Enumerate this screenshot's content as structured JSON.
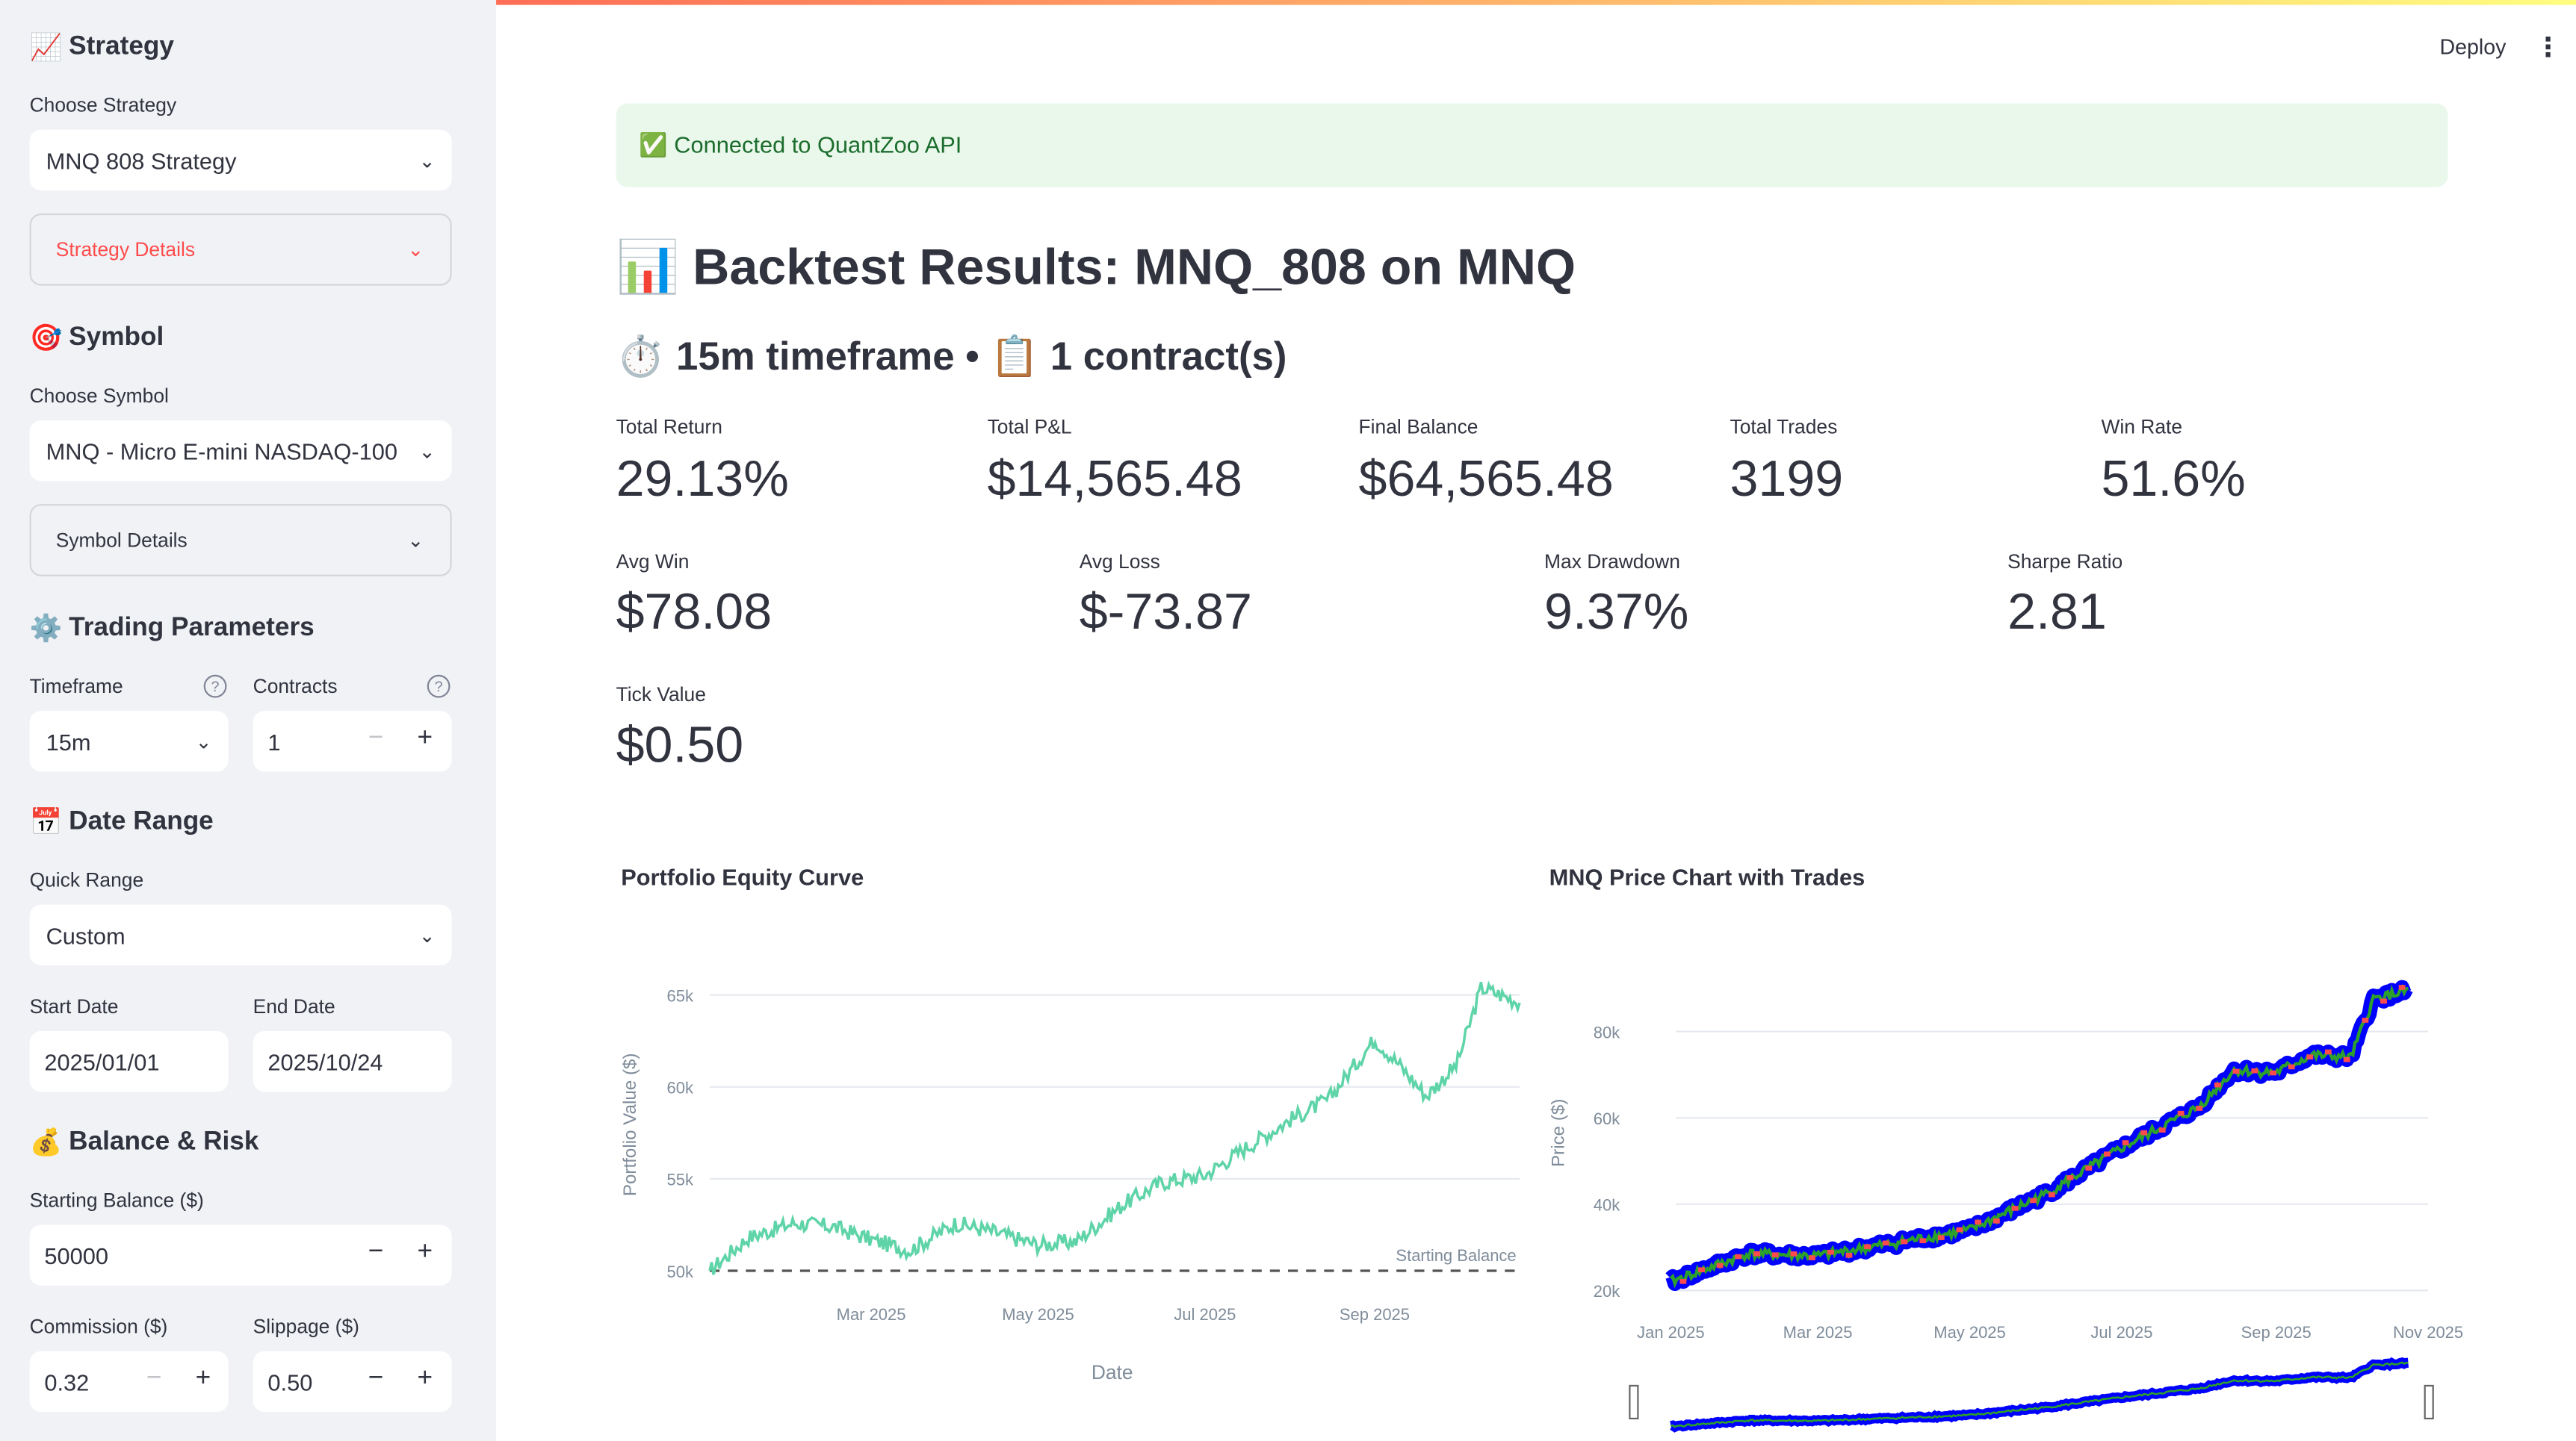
{
  "sidebar": {
    "strategy": {
      "heading": "Strategy",
      "icon": "📈",
      "choose_label": "Choose Strategy",
      "selected": "MNQ 808 Strategy",
      "details_label": "Strategy Details"
    },
    "symbol": {
      "heading": "Symbol",
      "icon": "🎯",
      "choose_label": "Choose Symbol",
      "selected": "MNQ - Micro E-mini NASDAQ-100",
      "details_label": "Symbol Details"
    },
    "trading": {
      "heading": "Trading Parameters",
      "icon": "⚙️",
      "timeframe_label": "Timeframe",
      "timeframe_value": "15m",
      "contracts_label": "Contracts",
      "contracts_value": "1"
    },
    "date_range": {
      "heading": "Date Range",
      "icon": "📅",
      "quick_label": "Quick Range",
      "quick_value": "Custom",
      "start_label": "Start Date",
      "start_value": "2025/01/01",
      "end_label": "End Date",
      "end_value": "2025/10/24"
    },
    "balance": {
      "heading": "Balance & Risk",
      "icon": "💰",
      "starting_label": "Starting Balance ($)",
      "starting_value": "50000",
      "commission_label": "Commission ($)",
      "commission_value": "0.32",
      "slippage_label": "Slippage ($)",
      "slippage_value": "0.50"
    }
  },
  "header": {
    "deploy_label": "Deploy",
    "menu_icon": "⋮"
  },
  "alert": {
    "text": "✅ Connected to QuantZoo API"
  },
  "title": {
    "icon": "📊",
    "text": "Backtest Results: MNQ_808 on MNQ"
  },
  "subtitle": {
    "text": "⏱️ 15m timeframe • 📋 1 contract(s)"
  },
  "metrics_row1": [
    {
      "label": "Total Return",
      "value": "29.13%"
    },
    {
      "label": "Total P&L",
      "value": "$14,565.48"
    },
    {
      "label": "Final Balance",
      "value": "$64,565.48"
    },
    {
      "label": "Total Trades",
      "value": "3199"
    },
    {
      "label": "Win Rate",
      "value": "51.6%"
    }
  ],
  "metrics_row2": [
    {
      "label": "Avg Win",
      "value": "$78.08"
    },
    {
      "label": "Avg Loss",
      "value": "$-73.87"
    },
    {
      "label": "Max Drawdown",
      "value": "9.37%"
    },
    {
      "label": "Sharpe Ratio",
      "value": "2.81"
    }
  ],
  "metrics_row3": [
    {
      "label": "Tick Value",
      "value": "$0.50"
    }
  ],
  "colors": {
    "equity_line": "#5fd4a8",
    "price_band": "#0000ff",
    "price_mid": "#2ca02c",
    "trade_markers": "#ff4b4b",
    "alert_bg": "#eaf8ec"
  },
  "chart_data": [
    {
      "type": "line",
      "title": "Portfolio Equity Curve",
      "xlabel": "Date",
      "ylabel": "Portfolio Value ($)",
      "xticks": [
        "Mar 2025",
        "May 2025",
        "Jul 2025",
        "Sep 2025"
      ],
      "yticks": [
        "50k",
        "55k",
        "60k",
        "65k"
      ],
      "ylim": [
        50000,
        65000
      ],
      "annotation": "Starting Balance",
      "baseline": 50000,
      "series": [
        {
          "x": [
            "2025-01-01",
            "2025-01-15",
            "2025-02-01",
            "2025-02-15",
            "2025-03-01",
            "2025-03-15",
            "2025-04-01",
            "2025-04-15",
            "2025-05-01",
            "2025-05-15",
            "2025-06-01",
            "2025-06-15",
            "2025-07-01",
            "2025-07-15",
            "2025-08-01",
            "2025-08-15",
            "2025-09-01",
            "2025-09-10",
            "2025-09-20",
            "2025-10-01",
            "2025-10-10",
            "2025-10-24"
          ],
          "values": [
            50000,
            51800,
            52600,
            52400,
            51700,
            51100,
            52600,
            52100,
            51400,
            51600,
            53600,
            54800,
            55200,
            56600,
            58200,
            59300,
            62600,
            61200,
            59500,
            61200,
            65400,
            64600
          ]
        }
      ]
    },
    {
      "type": "line",
      "title": "MNQ Price Chart with Trades",
      "ylabel": "Price ($)",
      "xticks": [
        "Jan 2025",
        "Mar 2025",
        "May 2025",
        "Jul 2025",
        "Sep 2025",
        "Nov 2025"
      ],
      "yticks": [
        "20k",
        "40k",
        "60k",
        "80k"
      ],
      "ylim": [
        20000,
        90000
      ],
      "series": [
        {
          "x": [
            "2025-01-01",
            "2025-02-01",
            "2025-03-01",
            "2025-04-01",
            "2025-05-01",
            "2025-06-01",
            "2025-07-01",
            "2025-08-01",
            "2025-08-15",
            "2025-09-01",
            "2025-09-15",
            "2025-10-01",
            "2025-10-10",
            "2025-10-24"
          ],
          "values": [
            22000,
            28500,
            28000,
            31000,
            34000,
            42500,
            53000,
            62500,
            71000,
            70500,
            74500,
            74000,
            87500,
            89500
          ]
        }
      ]
    }
  ]
}
